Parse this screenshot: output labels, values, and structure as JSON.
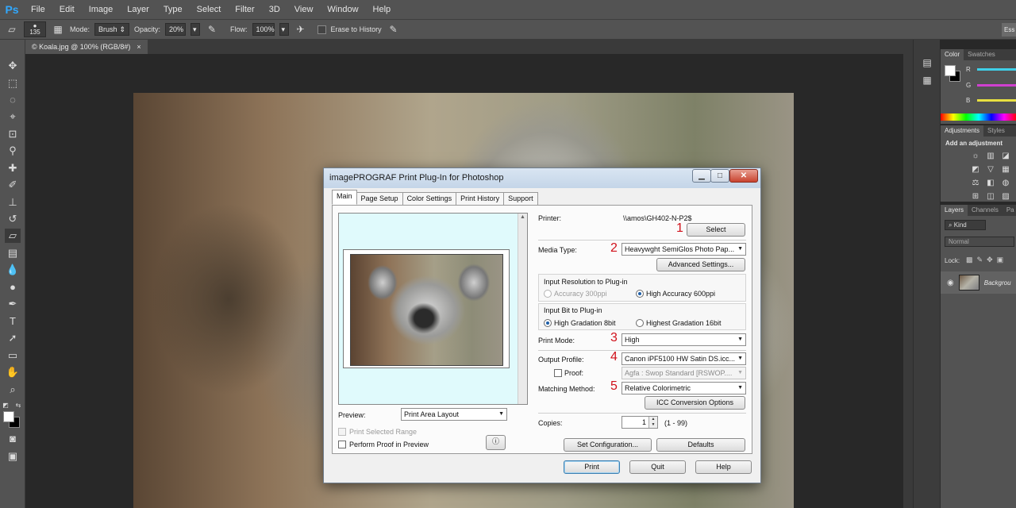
{
  "app": {
    "logo": "Ps",
    "menu": [
      "File",
      "Edit",
      "Image",
      "Layer",
      "Type",
      "Select",
      "Filter",
      "3D",
      "View",
      "Window",
      "Help"
    ]
  },
  "options_bar": {
    "brush_size": "135",
    "mode_label": "Mode:",
    "mode_value": "Brush",
    "opacity_label": "Opacity:",
    "opacity_value": "20%",
    "flow_label": "Flow:",
    "flow_value": "100%",
    "erase_history_label": "Erase to History",
    "workspace_button": "Ess"
  },
  "document": {
    "tab_title": "© Koala.jpg @ 100% (RGB/8#)",
    "close_glyph": "×"
  },
  "right_panels": {
    "color_tabs": [
      "Color",
      "Swatches"
    ],
    "sliders": [
      {
        "label": "R",
        "color": "#3fd0e8"
      },
      {
        "label": "G",
        "color": "#d040d0"
      },
      {
        "label": "B",
        "color": "#e8e040"
      }
    ],
    "adjust_tabs": [
      "Adjustments",
      "Styles"
    ],
    "adjust_title": "Add an adjustment",
    "layer_tabs": [
      "Layers",
      "Channels",
      "Pa"
    ],
    "layer_kind": "Kind",
    "layer_blend": "Normal",
    "layer_lock": "Lock:",
    "layer_name": "Backgrou"
  },
  "dialog": {
    "title": "imagePROGRAF Print Plug-In for Photoshop",
    "tabs": [
      "Main",
      "Page Setup",
      "Color Settings",
      "Print History",
      "Support"
    ],
    "printer_label": "Printer:",
    "printer_value": "\\\\amos\\GH402-N-P2$",
    "select_button": "Select",
    "media_type_label": "Media Type:",
    "media_type_value": "Heavywght SemiGlos Photo Pap...",
    "advanced_button": "Advanced Settings...",
    "input_res_title": "Input Resolution to Plug-in",
    "accuracy_300": "Accuracy 300ppi",
    "accuracy_600": "High Accuracy 600ppi",
    "input_bit_title": "Input Bit to Plug-in",
    "gradation_8": "High Gradation 8bit",
    "gradation_16": "Highest Gradation 16bit",
    "print_mode_label": "Print Mode:",
    "print_mode_value": "High",
    "output_profile_label": "Output Profile:",
    "output_profile_value": "Canon iPF5100 HW Satin DS.icc...",
    "proof_label": "Proof:",
    "proof_value": "Agfa : Swop Standard  [RSWOP....",
    "matching_label": "Matching Method:",
    "matching_value": "Relative Colorimetric",
    "icc_button": "ICC Conversion Options",
    "preview_label": "Preview:",
    "preview_value": "Print Area Layout",
    "print_selected": "Print Selected Range",
    "perform_proof": "Perform Proof in Preview",
    "copies_label": "Copies:",
    "copies_value": "1",
    "copies_range": "(1 - 99)",
    "set_config_button": "Set Configuration...",
    "defaults_button": "Defaults",
    "print_button": "Print",
    "quit_button": "Quit",
    "help_button": "Help",
    "annotations": [
      "1",
      "2",
      "3",
      "4",
      "5"
    ]
  }
}
